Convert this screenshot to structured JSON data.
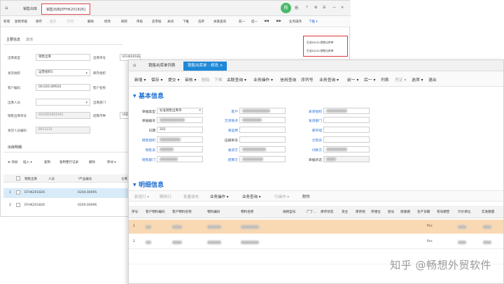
{
  "back_window": {
    "tabs": [
      {
        "label": "销售出库"
      },
      {
        "label": "销售出库[EFHK201826]"
      }
    ],
    "user_initial": "杨",
    "user_name": "杨",
    "toolbar": {
      "buttons": [
        "新增",
        "复制单据",
        "保存",
        "提交",
        "打印",
        "删除",
        "修改",
        "刷新",
        "审核",
        "反审核",
        "关闭",
        "下推",
        "选单",
        "关联查询",
        "前一",
        "后一",
        "业务操作"
      ],
      "last": "下推"
    },
    "context_menu": {
      "items": [
        "生成EXCEL销售出库单",
        "生成EXCEL销售出库单"
      ]
    },
    "section_tabs": [
      "主要信息",
      "其他"
    ],
    "fields": {
      "row1": {
        "label1": "出库类型",
        "value1": "销售出库",
        "label2": "出库单号",
        "value2": "EFHK201826"
      },
      "row2": {
        "label1": "发货组织",
        "value1": "运营组织1",
        "label2": "库存组织"
      },
      "row3": {
        "label1": "客户编码",
        "value1": "00.020.SM502",
        "label2": "客户名称"
      },
      "row4": {
        "label1": "出库人员",
        "label2": "出库部门"
      },
      "row5": {
        "label1": "销售出库单号",
        "value1": "XSCKD2001041",
        "label2": "结算币种",
        "value2": "USD"
      },
      "row6": {
        "label1": "发货人员编码",
        "value1": "6011231"
      }
    },
    "detail_tab": "出库明细",
    "grid_toolbar": [
      "添加",
      "插入",
      "复制",
      "复制整行记录",
      "删除",
      "移动"
    ],
    "grid_headers": [
      "销售出库",
      "人员",
      "*产品编号",
      "仓库"
    ],
    "grid_rows": [
      {
        "no": "1",
        "bill": "EFHK201826",
        "code": "0204.00095"
      },
      {
        "no": "2",
        "bill": "EFHK201826",
        "code": "0204.00096"
      }
    ]
  },
  "front_window": {
    "tabs": [
      {
        "label": "销售出库单列表"
      },
      {
        "label": "销售出库单 - 修改",
        "close": "×"
      }
    ],
    "menu": [
      "新增",
      "保存",
      "提交",
      "审核",
      "删除",
      "下推",
      "关联查询",
      "业务操作",
      "信用查询",
      "序列号",
      "业务查询",
      "前一",
      "后一",
      "列表",
      "凭证",
      "选项",
      "退出"
    ],
    "base_title": "基本信息",
    "base_fields": {
      "col1": [
        {
          "label": "单据类型",
          "value": "标准销售出库单",
          "blue": false
        },
        {
          "label": "单据编号",
          "value": "",
          "blue": false
        },
        {
          "label": "日期",
          "value": "202",
          "blue": false
        },
        {
          "label": "销售组织",
          "value": "",
          "blue": true
        },
        {
          "label": "销售员",
          "value": "",
          "blue": true
        },
        {
          "label": "销售部门",
          "value": "",
          "blue": true
        }
      ],
      "col2": [
        {
          "label": "客户",
          "blue": true
        },
        {
          "label": "交货地点",
          "blue": true
        },
        {
          "label": "承运商",
          "blue": true
        },
        {
          "label": "运输单号",
          "blue": false
        },
        {
          "label": "收货方",
          "blue": true
        },
        {
          "label": "结算方",
          "blue": true
        }
      ],
      "col3": [
        {
          "label": "发货组织",
          "value": "",
          "blue": true
        },
        {
          "label": "发货部门",
          "value": "",
          "blue": true
        },
        {
          "label": "库存组",
          "value": "",
          "blue": true
        },
        {
          "label": "仓管员",
          "value": "",
          "blue": true
        },
        {
          "label": "付款方",
          "value": "",
          "blue": true
        },
        {
          "label": "单据状态",
          "value": "",
          "blue": false
        }
      ]
    },
    "detail_title": "明细信息",
    "detail_toolbar": [
      "新增行",
      "删除行",
      "批量填充",
      "业务操作",
      "业务查询",
      "行操作",
      "附件"
    ],
    "table_headers": [
      "序号",
      "客户物料编码",
      "客户物料名称",
      "物料编码",
      "物料名称",
      "规格型号",
      "广了...",
      "库存状态",
      "货主",
      "库存组",
      "存储位",
      "批号",
      "保质期",
      "生产日期",
      "有效期至",
      "计价单位",
      "实发数量"
    ],
    "table_rows": [
      {
        "no": "1",
        "unit": "Pcs"
      },
      {
        "no": "2",
        "unit": "Pcs"
      }
    ]
  },
  "watermark": "知乎 @畅想外贸软件"
}
